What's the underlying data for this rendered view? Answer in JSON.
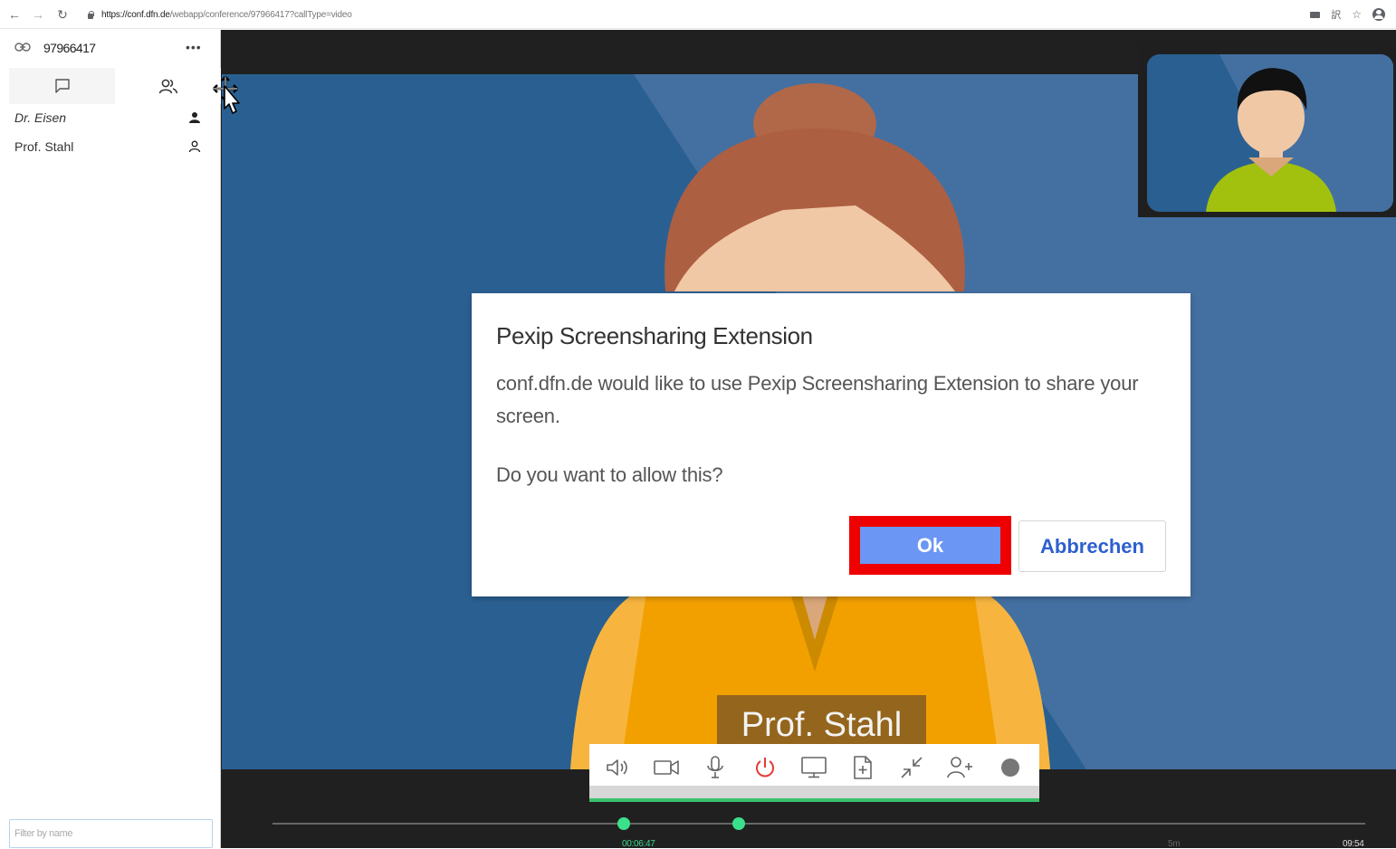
{
  "browser": {
    "url_host": "https://conf.dfn.de",
    "url_path": "/webapp/conference/97966417?callType=video"
  },
  "sidebar": {
    "conference_id": "97966417",
    "participants": [
      {
        "name": "Dr. Eisen"
      },
      {
        "name": "Prof. Stahl"
      }
    ],
    "filter_placeholder": "Filter by name"
  },
  "video": {
    "speaker_name": "Prof. Stahl"
  },
  "toolbar": {
    "icons": [
      "speaker-icon",
      "camera-icon",
      "microphone-icon",
      "power-icon",
      "screen-share-icon",
      "add-file-icon",
      "minimize-icon",
      "add-user-icon",
      "record-icon"
    ]
  },
  "timeline": {
    "elapsed": "00:06:47",
    "marker": "5m",
    "total": "09:54"
  },
  "dialog": {
    "title": "Pexip Screensharing Extension",
    "message": "conf.dfn.de would like to use Pexip Screensharing Extension to share your screen.",
    "question": "Do you want to allow this?",
    "ok_label": "Ok",
    "cancel_label": "Abbrechen"
  },
  "colors": {
    "video_background": "#2a6091",
    "accent_green": "#39c16c",
    "ok_button": "#6b96f3",
    "highlight_red": "#ee0000",
    "hangup_red": "#e53935"
  }
}
